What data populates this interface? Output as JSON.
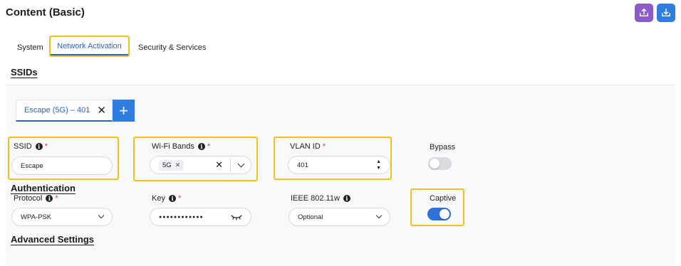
{
  "header": {
    "title": "Content (Basic)",
    "export_icon": "upload-icon",
    "import_icon": "download-icon"
  },
  "tabs": [
    {
      "label": "System"
    },
    {
      "label": "Network Activation",
      "active": true
    },
    {
      "label": "Security & Services"
    }
  ],
  "section": {
    "title": "SSIDs"
  },
  "ssid_tabs": {
    "active_label": "Escape (5G) – 401",
    "close_glyph": "✕",
    "add_glyph": "+"
  },
  "fields": {
    "ssid": {
      "label": "SSID",
      "value": "Escape"
    },
    "wifi_bands": {
      "label": "Wi-Fi Bands",
      "chip": "5G"
    },
    "vlan_id": {
      "label": "VLAN ID",
      "value": "401"
    },
    "bypass": {
      "label": "Bypass",
      "on": false
    }
  },
  "authentication": {
    "title": "Authentication",
    "protocol": {
      "label": "Protocol",
      "value": "WPA-PSK"
    },
    "key": {
      "label": "Key",
      "value": "●●●●●●●●●●●●"
    },
    "ieee": {
      "label": "IEEE 802.11w",
      "value": "Optional"
    },
    "captive": {
      "label": "Captive",
      "on": true
    }
  },
  "advanced": {
    "title": "Advanced Settings"
  },
  "colors": {
    "accent": "#2f7de0",
    "export_btn": "#8b5cc7",
    "highlight": "#f2c21a",
    "required": "#e23b3b"
  }
}
